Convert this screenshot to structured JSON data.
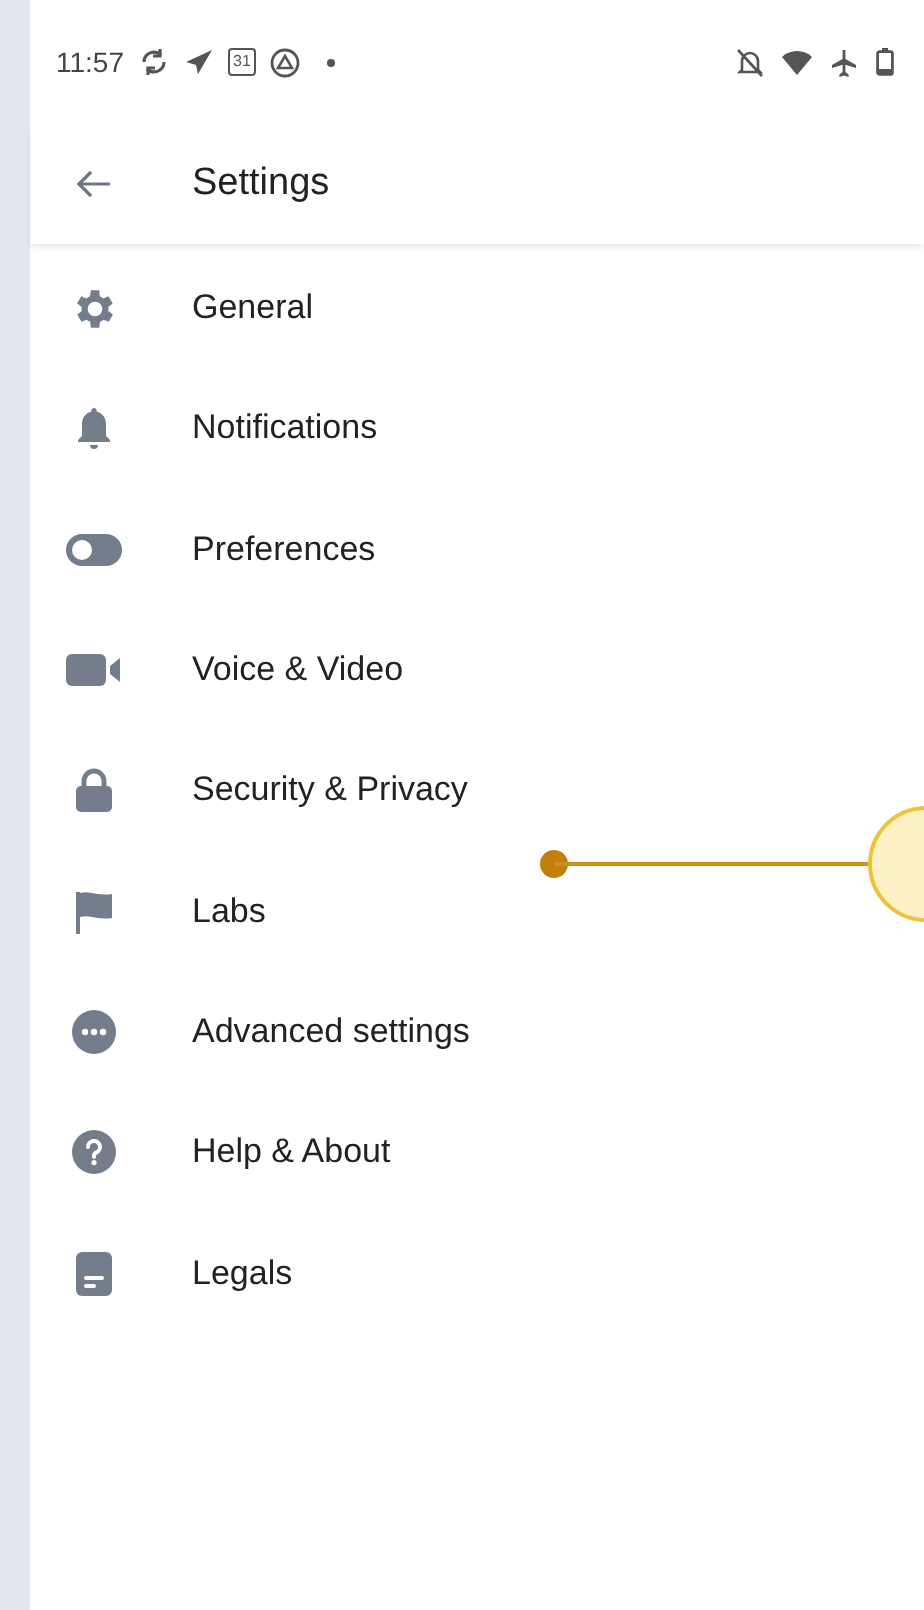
{
  "status_bar": {
    "time": "11:57",
    "calendar_day": "31"
  },
  "header": {
    "title": "Settings"
  },
  "items": [
    {
      "label": "General"
    },
    {
      "label": "Notifications"
    },
    {
      "label": "Preferences"
    },
    {
      "label": "Voice & Video"
    },
    {
      "label": "Security & Privacy"
    },
    {
      "label": "Labs"
    },
    {
      "label": "Advanced settings"
    },
    {
      "label": "Help & About"
    },
    {
      "label": "Legals"
    }
  ]
}
